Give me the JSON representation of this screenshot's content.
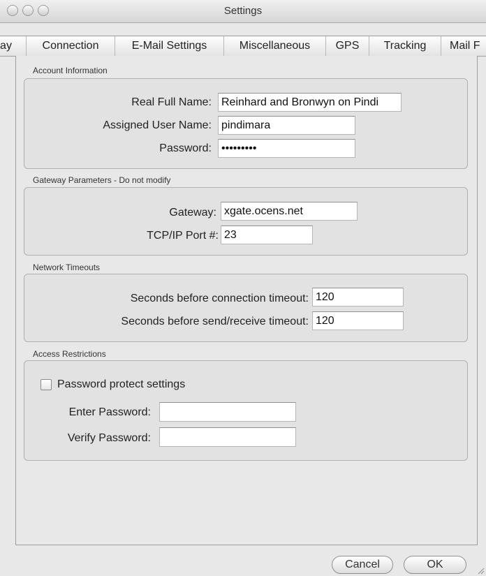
{
  "window": {
    "title": "Settings"
  },
  "tabs": [
    "ay",
    "Connection",
    "E-Mail Settings",
    "Miscellaneous",
    "GPS",
    "Tracking",
    "Mail F"
  ],
  "account": {
    "section_label": "Account Information",
    "real_name_label": "Real Full Name:",
    "real_name_value": "Reinhard and Bronwyn on Pindi",
    "user_name_label": "Assigned User Name:",
    "user_name_value": "pindimara",
    "password_label": "Password:",
    "password_value": "•••••••••"
  },
  "gateway": {
    "section_label": "Gateway Parameters - Do not modify",
    "gateway_label": "Gateway:",
    "gateway_value": "xgate.ocens.net",
    "port_label": "TCP/IP Port #:",
    "port_value": "23"
  },
  "timeouts": {
    "section_label": "Network Timeouts",
    "connect_label": "Seconds before connection timeout:",
    "connect_value": "120",
    "sendrecv_label": "Seconds before send/receive timeout:",
    "sendrecv_value": "120"
  },
  "access": {
    "section_label": "Access Restrictions",
    "protect_label": "Password protect settings",
    "protect_checked": false,
    "enter_label": "Enter Password:",
    "enter_value": "",
    "verify_label": "Verify Password:",
    "verify_value": ""
  },
  "buttons": {
    "cancel": "Cancel",
    "ok": "OK"
  }
}
